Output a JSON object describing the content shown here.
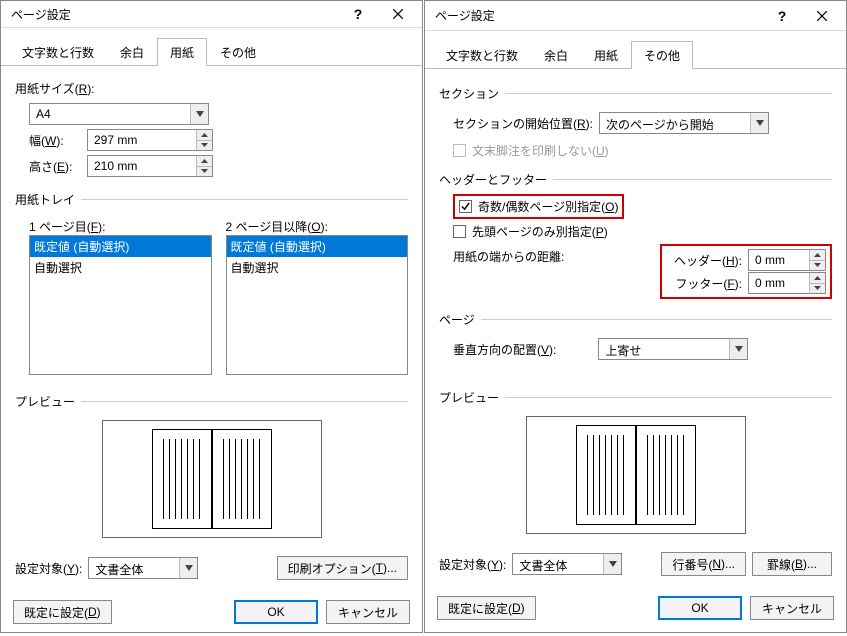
{
  "left": {
    "title": "ページ設定",
    "tabs": [
      "文字数と行数",
      "余白",
      "用紙",
      "その他"
    ],
    "active_tab": 2,
    "paper_size_label": "用紙サイズ(R):",
    "paper_size_value": "A4",
    "width_label": "幅(W):",
    "width_value": "297 mm",
    "height_label": "高さ(E):",
    "height_value": "210 mm",
    "tray_label": "用紙トレイ",
    "page1_label": "1 ページ目(F):",
    "page2_label": "2 ページ目以降(O):",
    "tray1_items": [
      "既定値 (自動選択)",
      "自動選択"
    ],
    "tray2_items": [
      "既定値 (自動選択)",
      "自動選択"
    ],
    "preview_label": "プレビュー",
    "apply_to_label": "設定対象(Y):",
    "apply_to_value": "文書全体",
    "print_options": "印刷オプション(T)...",
    "default_btn": "既定に設定(D)",
    "ok": "OK",
    "cancel": "キャンセル"
  },
  "right": {
    "title": "ページ設定",
    "tabs": [
      "文字数と行数",
      "余白",
      "用紙",
      "その他"
    ],
    "active_tab": 3,
    "section_label": "セクション",
    "section_start_label": "セクションの開始位置(R):",
    "section_start_value": "次のページから開始",
    "suppress_endnote": "文末脚注を印刷しない(U)",
    "hf_label": "ヘッダーとフッター",
    "odd_even": "奇数/偶数ページ別指定(O)",
    "first_page": "先頭ページのみ別指定(P)",
    "edge_label": "用紙の端からの距離:",
    "header_label": "ヘッダー(H):",
    "header_value": "0 mm",
    "footer_label": "フッター(F):",
    "footer_value": "0 mm",
    "page_label": "ページ",
    "valign_label": "垂直方向の配置(V):",
    "valign_value": "上寄せ",
    "preview_label": "プレビュー",
    "apply_to_label": "設定対象(Y):",
    "apply_to_value": "文書全体",
    "line_numbers": "行番号(N)...",
    "borders": "罫線(B)...",
    "default_btn": "既定に設定(D)",
    "ok": "OK",
    "cancel": "キャンセル"
  }
}
